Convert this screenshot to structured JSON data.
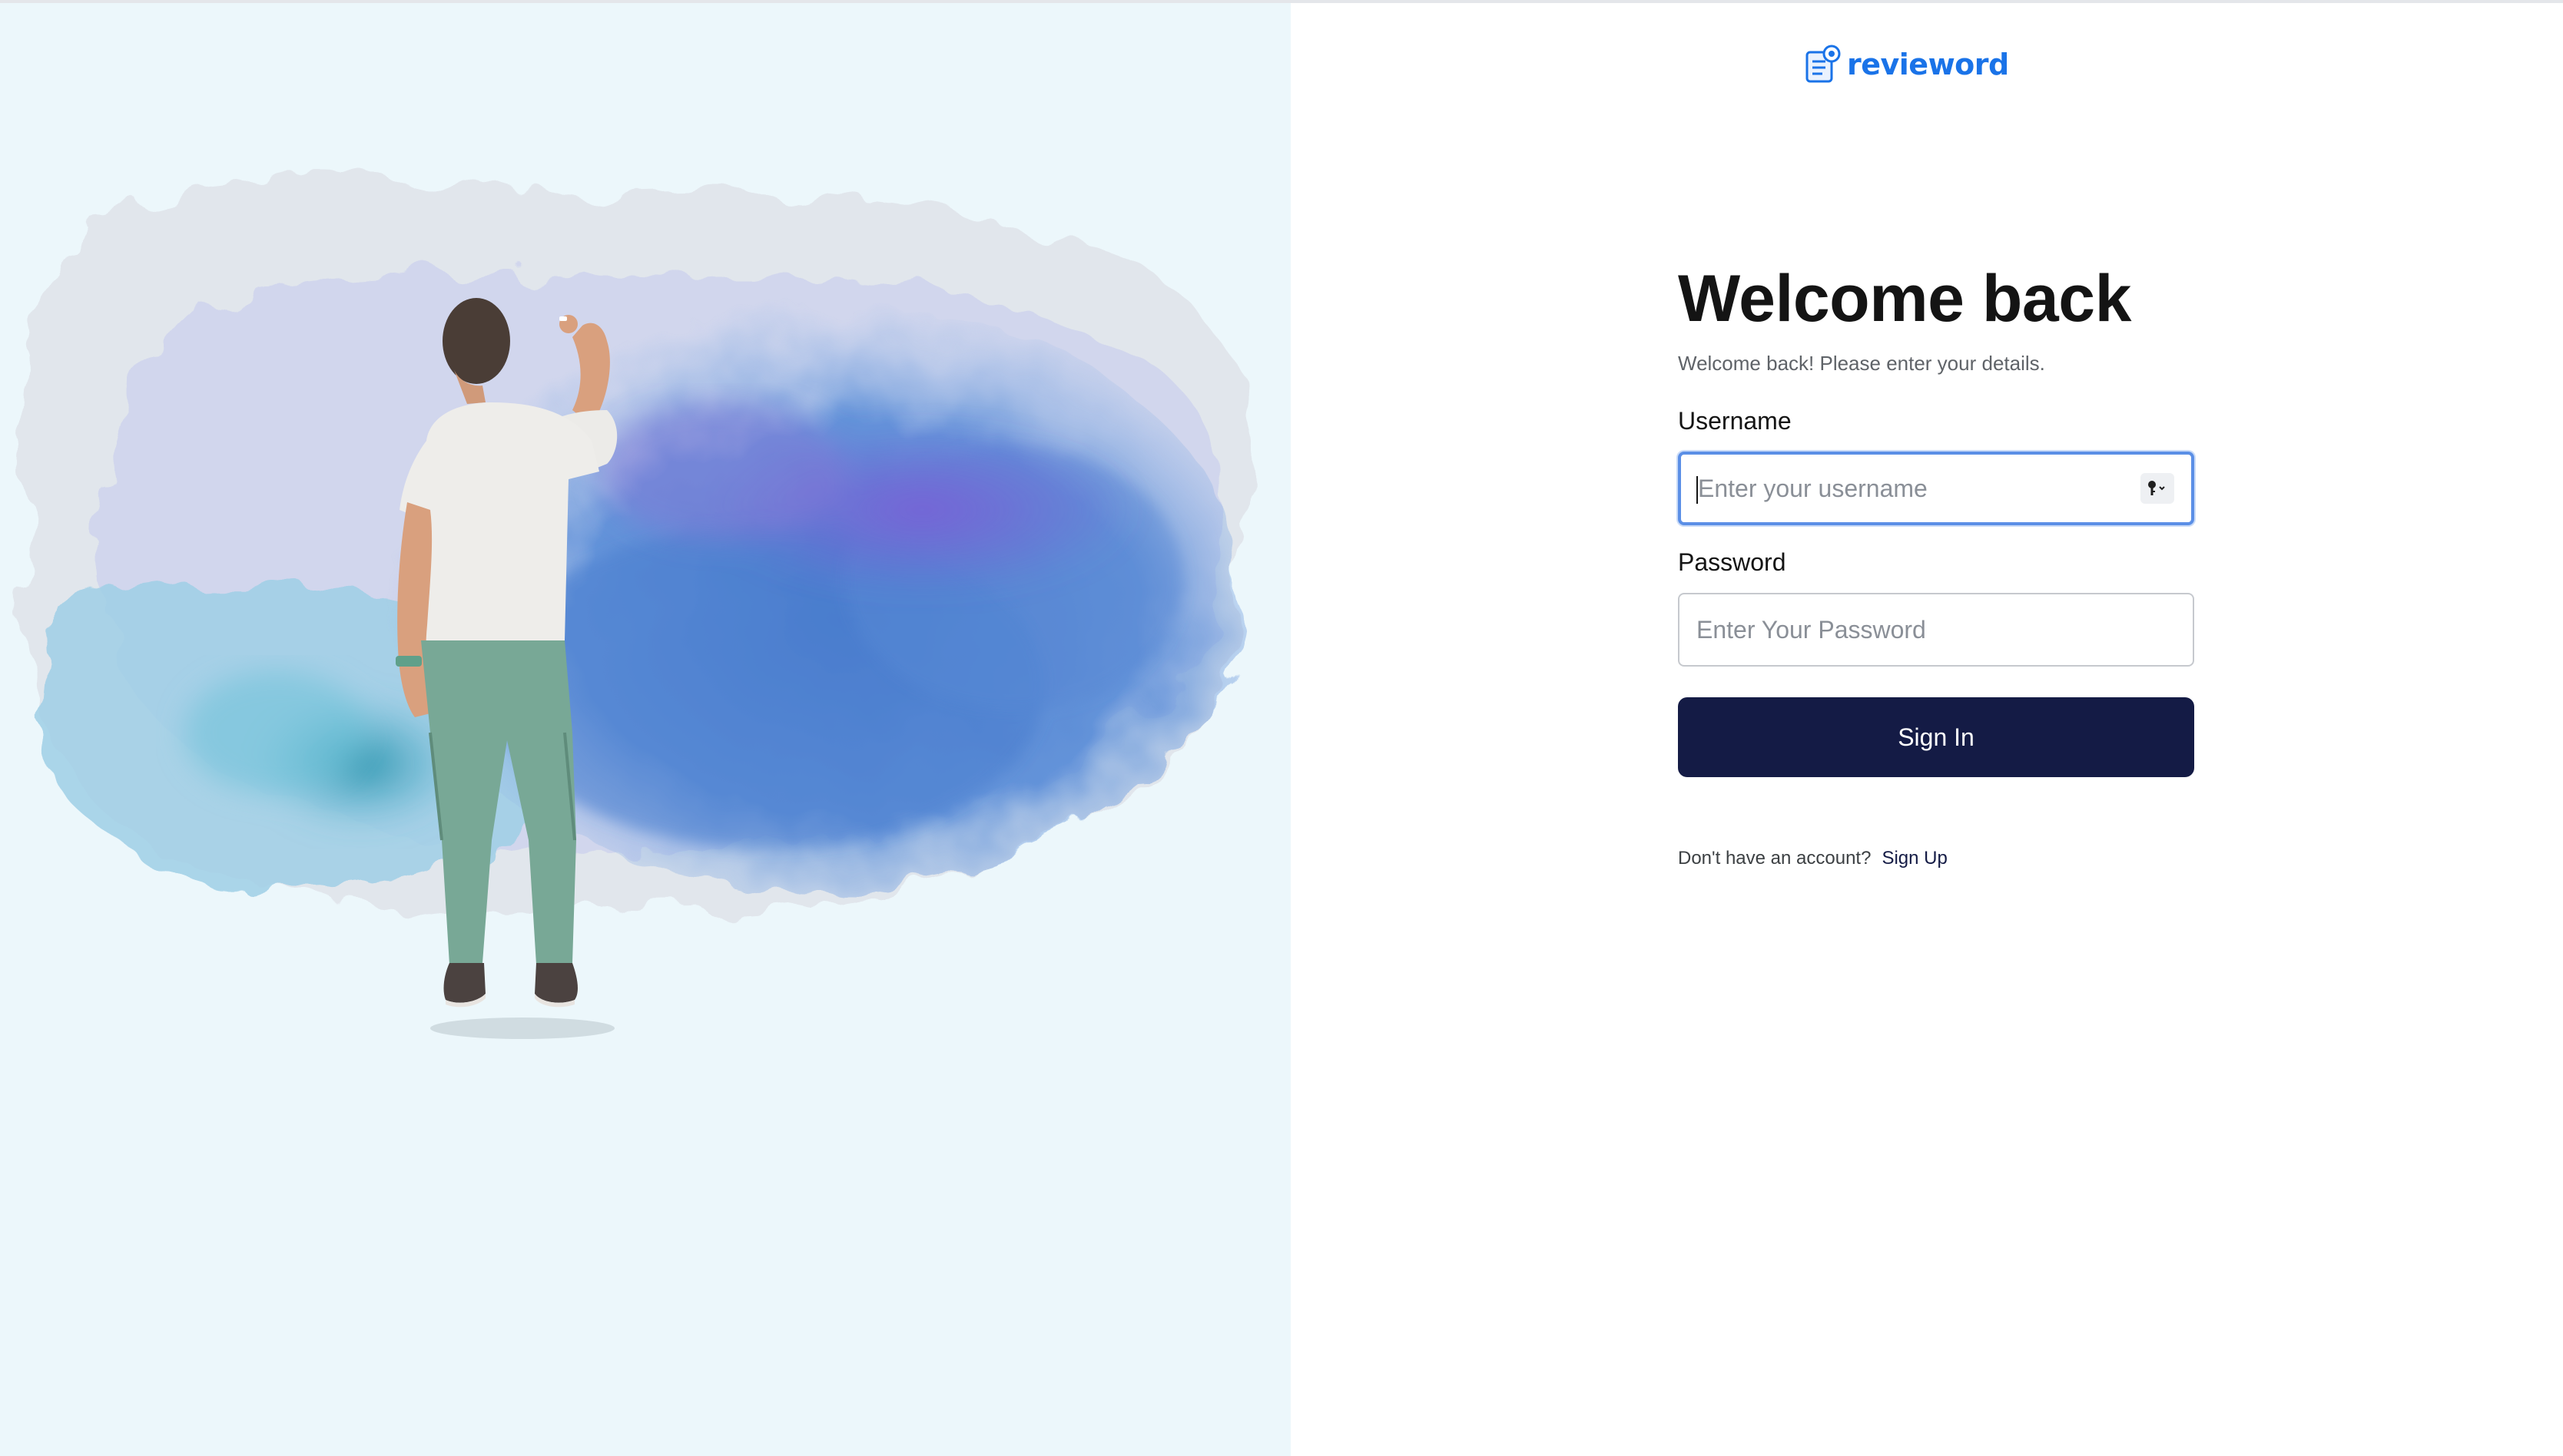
{
  "brand": {
    "name": "revieword",
    "color": "#1a73e8"
  },
  "login": {
    "title": "Welcome back",
    "subtitle": "Welcome back! Please enter your details.",
    "username_label": "Username",
    "username_placeholder": "Enter your username",
    "username_value": "",
    "password_label": "Password",
    "password_placeholder": "Enter Your Password",
    "password_value": "",
    "signin_label": "Sign In",
    "signup_prompt": "Don't have an account?",
    "signup_link": "Sign Up"
  },
  "icons": {
    "logo": "document-badge-icon",
    "password_manager": "key-icon"
  },
  "colors": {
    "left_panel_bg": "#ecf7fb",
    "primary_button": "#141b45",
    "focus_ring": "#5b8fe6"
  },
  "illustration": {
    "subject": "person-painting-watercolor-wall"
  }
}
